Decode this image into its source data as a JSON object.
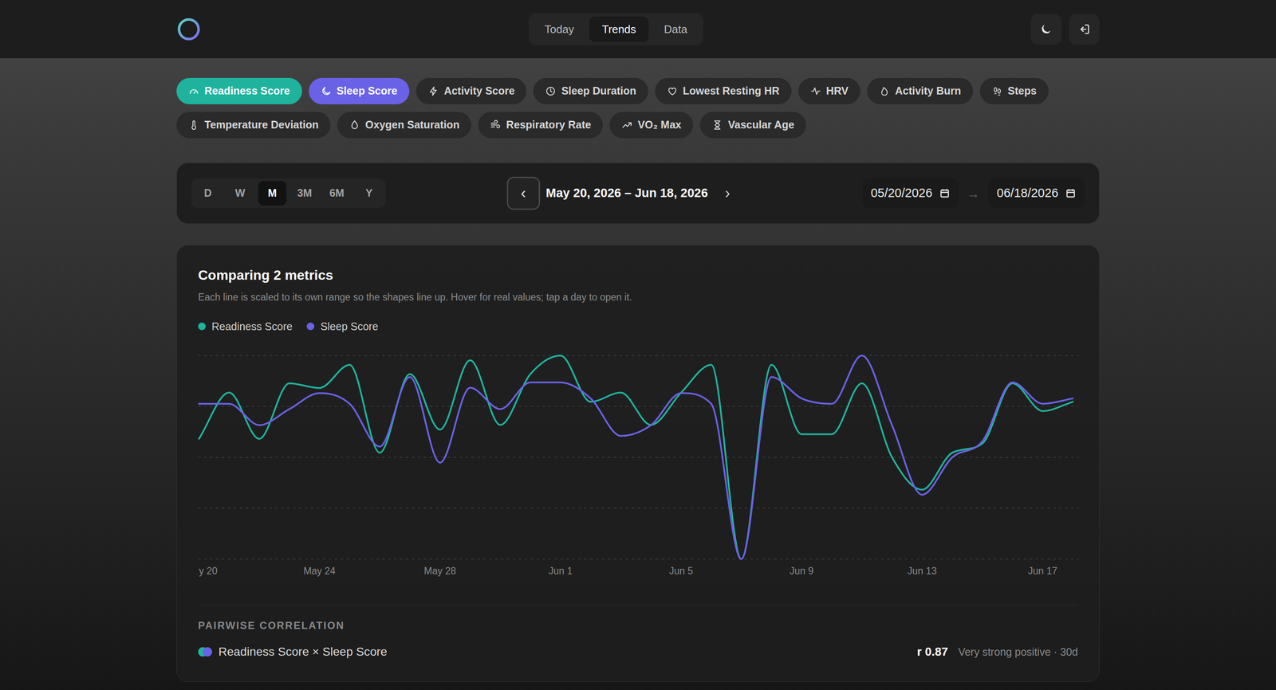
{
  "header": {
    "nav": [
      {
        "label": "Today",
        "selected": false
      },
      {
        "label": "Trends",
        "selected": true
      },
      {
        "label": "Data",
        "selected": false
      }
    ]
  },
  "metrics": [
    {
      "label": "Readiness Score",
      "selected": true,
      "color": "#1fb39d"
    },
    {
      "label": "Sleep Score",
      "selected": true,
      "color": "#6a62e6"
    },
    {
      "label": "Activity Score",
      "selected": false
    },
    {
      "label": "Sleep Duration",
      "selected": false
    },
    {
      "label": "Lowest Resting HR",
      "selected": false
    },
    {
      "label": "HRV",
      "selected": false
    },
    {
      "label": "Activity Burn",
      "selected": false
    },
    {
      "label": "Steps",
      "selected": false
    },
    {
      "label": "Temperature Deviation",
      "selected": false
    },
    {
      "label": "Oxygen Saturation",
      "selected": false
    },
    {
      "label": "Respiratory Rate",
      "selected": false
    },
    {
      "label": "VO₂ Max",
      "selected": false
    },
    {
      "label": "Vascular Age",
      "selected": false
    }
  ],
  "range": {
    "periods": [
      {
        "label": "D",
        "selected": false
      },
      {
        "label": "W",
        "selected": false
      },
      {
        "label": "M",
        "selected": true
      },
      {
        "label": "3M",
        "selected": false
      },
      {
        "label": "6M",
        "selected": false
      },
      {
        "label": "Y",
        "selected": false
      }
    ],
    "prev": "‹",
    "label": "May 20, 2026 – Jun 18, 2026",
    "next": "›",
    "start": "05/20/2026",
    "arrow": "→",
    "end": "06/18/2026"
  },
  "chart": {
    "title": "Comparing 2 metrics",
    "subtitle": "Each line is scaled to its own range so the shapes line up. Hover for real values; tap a day to open it.",
    "series": [
      {
        "name": "Readiness Score",
        "color": "#1fb39d",
        "values": [
          74,
          84,
          74,
          86,
          85,
          90,
          71,
          88,
          76,
          91,
          77,
          88,
          92,
          82,
          84,
          77,
          84,
          90,
          48,
          90,
          75,
          75,
          86,
          70,
          63,
          71,
          73,
          86,
          80,
          82
        ]
      },
      {
        "name": "Sleep Score",
        "color": "#6a62e6",
        "values": [
          81,
          81,
          77,
          80,
          83,
          81,
          73,
          86,
          70,
          84,
          80,
          85,
          85,
          82,
          75,
          77,
          83,
          81,
          52,
          86,
          82,
          81,
          90,
          77,
          64,
          71,
          74,
          85,
          81,
          82
        ]
      }
    ],
    "x_ticks": [
      "y 20",
      "May 24",
      "May 28",
      "Jun 1",
      "Jun 5",
      "Jun 9",
      "Jun 13",
      "Jun 17"
    ]
  },
  "correlation": {
    "heading": "PAIRWISE CORRELATION",
    "pairs": [
      {
        "label": "Readiness Score × Sleep Score",
        "colors": [
          "#1fb39d",
          "#6a62e6"
        ],
        "r": "r 0.87",
        "description": "Very strong positive · 30d"
      }
    ]
  }
}
